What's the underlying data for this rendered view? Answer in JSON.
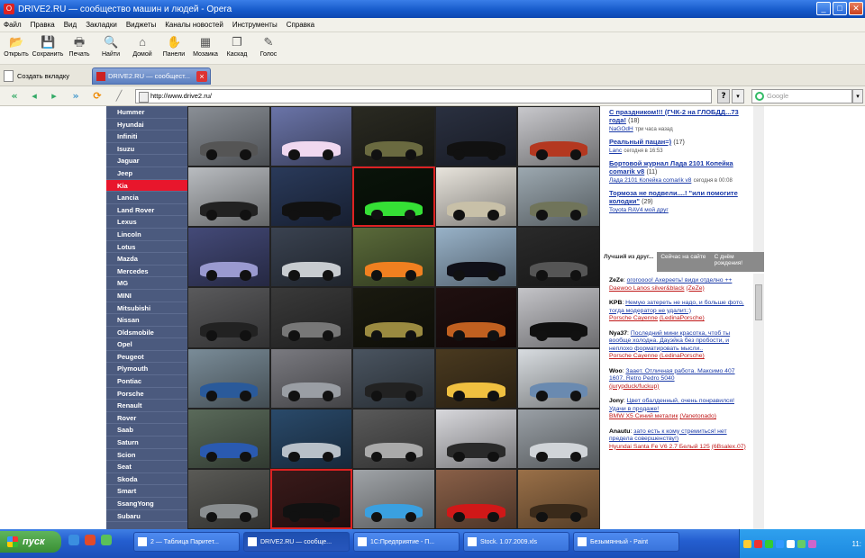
{
  "window": {
    "title": "DRIVE2.RU — сообщество машин и людей - Opera"
  },
  "menu": [
    "Файл",
    "Правка",
    "Вид",
    "Закладки",
    "Виджеты",
    "Каналы новостей",
    "Инструменты",
    "Справка"
  ],
  "toolbar": [
    {
      "label": "Открыть",
      "icon": "folder-icon",
      "glyph": "📂"
    },
    {
      "label": "Сохранить",
      "icon": "save-icon",
      "glyph": "💾"
    },
    {
      "label": "Печать",
      "icon": "print-icon",
      "glyph": "🖶"
    },
    {
      "label": "Найти",
      "icon": "find-icon",
      "glyph": "🔍"
    },
    {
      "label": "Домой",
      "icon": "home-icon",
      "glyph": "⌂"
    },
    {
      "label": "Панели",
      "icon": "panels-icon",
      "glyph": "✋"
    },
    {
      "label": "Мозаика",
      "icon": "tile-icon",
      "glyph": "▦"
    },
    {
      "label": "Каскад",
      "icon": "cascade-icon",
      "glyph": "❐"
    },
    {
      "label": "Голос",
      "icon": "voice-icon",
      "glyph": "✎"
    }
  ],
  "tabs": {
    "new_tab": "Создать вкладку",
    "active": "DRIVE2.RU — сообщест..."
  },
  "address": {
    "url": "http://www.drive2.ru/",
    "search_placeholder": "Google"
  },
  "brands": [
    "Hummer",
    "Hyundai",
    "Infiniti",
    "Isuzu",
    "Jaguar",
    "Jeep",
    "Kia",
    "Lancia",
    "Land Rover",
    "Lexus",
    "Lincoln",
    "Lotus",
    "Mazda",
    "Mercedes",
    "MG",
    "MINI",
    "Mitsubishi",
    "Nissan",
    "Oldsmobile",
    "Opel",
    "Peugeot",
    "Plymouth",
    "Pontiac",
    "Porsche",
    "Renault",
    "Rover",
    "Saab",
    "Saturn",
    "Scion",
    "Seat",
    "Skoda",
    "Smart",
    "SsangYong",
    "Subaru"
  ],
  "active_brand": "Kia",
  "photo_tiles": [
    {
      "bg": "#8a8f96",
      "car": "#555"
    },
    {
      "bg": "#6a74a8",
      "car": "#f0d8f0"
    },
    {
      "bg": "#2a2a22",
      "car": "#6a6a40"
    },
    {
      "bg": "#2a3040",
      "car": "#111"
    },
    {
      "bg": "#c8c8cc",
      "car": "#b43820"
    },
    {
      "bg": "#b9bcc0",
      "car": "#222"
    },
    {
      "bg": "#2a3a5a",
      "car": "#111"
    },
    {
      "bg": "#0a140a",
      "car": "#35e035",
      "red": true
    },
    {
      "bg": "#e8e4dc",
      "car": "#c8c0a8"
    },
    {
      "bg": "#9ca8b0",
      "car": "#70745a"
    },
    {
      "bg": "#444a78",
      "car": "#9a9ad0"
    },
    {
      "bg": "#3a4250",
      "car": "#c8ccd0"
    },
    {
      "bg": "#5a6a3a",
      "car": "#f08020"
    },
    {
      "bg": "#98b2c8",
      "car": "#101018"
    },
    {
      "bg": "#2a2a2a",
      "car": "#555"
    },
    {
      "bg": "#5a5a5c",
      "car": "#222"
    },
    {
      "bg": "#3a3a3a",
      "car": "#777"
    },
    {
      "bg": "#1a1a10",
      "car": "#9a8a40"
    },
    {
      "bg": "#201010",
      "car": "#c06020"
    },
    {
      "bg": "#c4c4c8",
      "car": "#101010"
    },
    {
      "bg": "#7a8c98",
      "car": "#2a5a9a"
    },
    {
      "bg": "#7a7a80",
      "car": "#9a9ea4"
    },
    {
      "bg": "#4a5460",
      "car": "#222"
    },
    {
      "bg": "#4a3a20",
      "car": "#f0c040"
    },
    {
      "bg": "#d8dce0",
      "car": "#6a8ab0"
    },
    {
      "bg": "#5a6a5a",
      "car": "#2a5ab0"
    },
    {
      "bg": "#2a4a6a",
      "car": "#b8c0c8"
    },
    {
      "bg": "#5a5a5a",
      "car": "#aaa"
    },
    {
      "bg": "#d8d8dc",
      "car": "#2a2a2a"
    },
    {
      "bg": "#9aa0a6",
      "car": "#d0d4d8"
    },
    {
      "bg": "#5a5a56",
      "car": "#8a8e90"
    },
    {
      "bg": "#3a1a1a",
      "car": "#111",
      "red": true
    },
    {
      "bg": "#a0a4a8",
      "car": "#3aa0e0"
    },
    {
      "bg": "#8a6048",
      "car": "#d01818"
    },
    {
      "bg": "#9a7048",
      "car": "#3a2a1a"
    }
  ],
  "news": [
    {
      "title": "С праздником!!! (ГЧК-2 на ГЛОБДД...73 года!",
      "count": "(18)",
      "user": "NaGOdH",
      "meta": "три часа назад"
    },
    {
      "title": "Реальный пацан=)",
      "count": "(17)",
      "user": "Lanc",
      "meta": "сегодня в 16:53"
    },
    {
      "title": "Бортовой журнал Лада 2101 Копейка comarik v8",
      "count": "(11)",
      "sub": "Лада 2101 Копейка comarik v8",
      "meta": "сегодня в 00:08"
    },
    {
      "title": "Тормоза не подвели....! \"или помогите колодки\"",
      "count": "(29)",
      "sub": "Toyota RAV4 мой друг"
    }
  ],
  "side_tabs": {
    "active": "Лучший из друг...",
    "tab2": "Сейчас на сайте",
    "tab3": "С днём рождения!"
  },
  "comments": [
    {
      "user": "ZeZe",
      "text": "огогоооо! Ахерееть! види отделно ++",
      "link": "Daewoo Lanos silver&black",
      "author": "(ZeZe)"
    },
    {
      "user": "KPB",
      "text": "Немую затереть не надо, и больше фото, тогда модератор не удалит.:)",
      "link": "Porsche Cayenne",
      "author": "(LedinaPorsche)"
    },
    {
      "user": "Nya37",
      "text": "Последний мини красотка, чтоб ты вообще холодна. Дауэйка без пробости, и неплохо форматировать мысли..",
      "link": "Porsche Cayenne",
      "author": "(LedinaPorsche)"
    },
    {
      "user": "Woo",
      "text": "Заает. Отличная работа. Максимо 407 1607. Retro Pedro 5040",
      "link": "",
      "author": "(jurypduck/fuckup)"
    },
    {
      "user": "Jony",
      "text": "Цвет обалденный, очень понравился! Удачи в продаже!",
      "link": "BMW X5 Синий металик",
      "author": "(Vanetonado)"
    },
    {
      "user": "Anautu",
      "text": "зато есть к кому стремиться! нет предела совершенству!)",
      "link": "Hyundai Santa Fe V6 2.7 Белый 125",
      "author": "(6Bsalex.07)"
    }
  ],
  "taskbar": {
    "start": "пуск",
    "tasks": [
      "2 — Таблица Паритет...",
      "DRIVE2.RU — сообще...",
      "1С:Предприятие - П...",
      "Stock. 1.07.2009.xls",
      "Безымянный - Paint"
    ],
    "active_task": "DRIVE2.RU — сообще...",
    "clock": "11:"
  }
}
